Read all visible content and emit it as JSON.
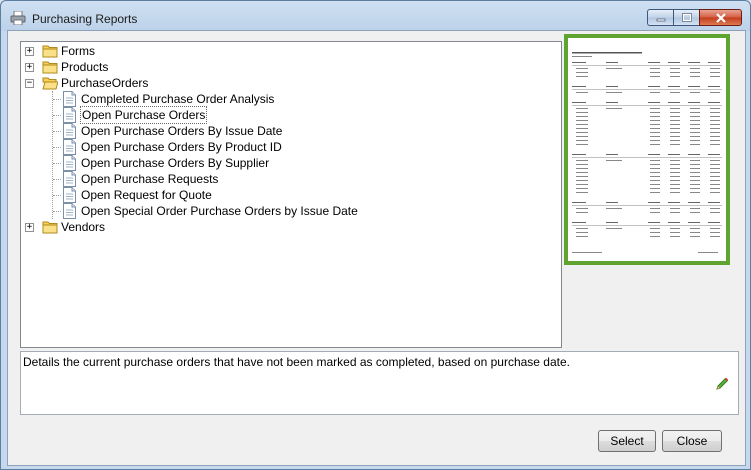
{
  "window": {
    "title": "Purchasing Reports",
    "controls": {
      "minimize": "–",
      "maximize": "□",
      "close": "✕"
    }
  },
  "tree": {
    "nodes": [
      {
        "label": "Forms",
        "type": "folder",
        "expander": "+"
      },
      {
        "label": "Products",
        "type": "folder",
        "expander": "+"
      },
      {
        "label": "PurchaseOrders",
        "type": "folder",
        "expander": "−"
      },
      {
        "label": "Completed Purchase Order Analysis",
        "type": "report"
      },
      {
        "label": "Open Purchase Orders",
        "type": "report",
        "selected": true
      },
      {
        "label": "Open Purchase Orders By Issue Date",
        "type": "report"
      },
      {
        "label": "Open Purchase Orders By Product ID",
        "type": "report"
      },
      {
        "label": "Open Purchase Orders By Supplier",
        "type": "report"
      },
      {
        "label": "Open Purchase Requests",
        "type": "report"
      },
      {
        "label": "Open Request for Quote",
        "type": "report"
      },
      {
        "label": "Open Special Order Purchase Orders by Issue Date",
        "type": "report"
      },
      {
        "label": "Vendors",
        "type": "folder",
        "expander": "+"
      }
    ]
  },
  "preview": {
    "border_color": "#5fa430",
    "icon": "report-thumbnail"
  },
  "description": {
    "text": "Details the current purchase orders that have not been marked as completed, based on purchase date.",
    "icon": "pencil-icon"
  },
  "buttons": {
    "select": "Select",
    "close": "Close"
  }
}
